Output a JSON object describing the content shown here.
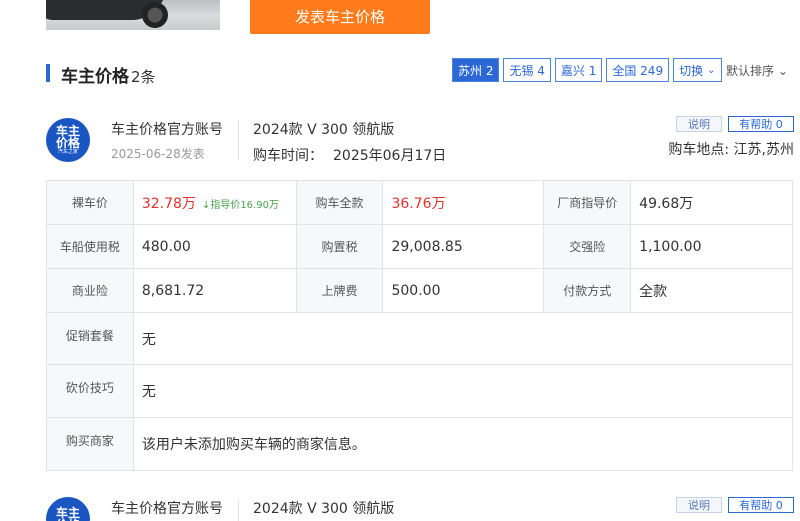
{
  "top": {
    "publish_label": "发表车主价格"
  },
  "section": {
    "title": "车主价格",
    "count": "2条"
  },
  "cities": [
    {
      "label": "苏州 2",
      "active": true
    },
    {
      "label": "无锡 4"
    },
    {
      "label": "嘉兴 1"
    },
    {
      "label": "全国 249"
    },
    {
      "label": "切换"
    }
  ],
  "sort": {
    "label": "默认排序"
  },
  "records": [
    {
      "avatar_text_big": "车主\n价格",
      "avatar_text_small": "汽车之家",
      "owner": "车主价格官方账号",
      "date": "2025-06-28发表",
      "model": "2024款 V 300 领航版",
      "buy_date_label": "购车时间：",
      "buy_date": "2025年06月17日",
      "explain": "说明",
      "helpful": "有帮助 0",
      "location": "购车地点: 江苏,苏州",
      "rows": {
        "bare_price_label": "裸车价",
        "bare_price": "32.78万",
        "guide_note": "↓指导价16.90万",
        "total_label": "购车全款",
        "total": "36.76万",
        "msrp_label": "厂商指导价",
        "msrp": "49.68万",
        "vehicle_tax_label": "车船使用税",
        "vehicle_tax": "480.00",
        "purchase_tax_label": "购置税",
        "purchase_tax": "29,008.85",
        "compulsory_label": "交强险",
        "compulsory": "1,100.00",
        "commercial_label": "商业险",
        "commercial": "8,681.72",
        "plate_label": "上牌费",
        "plate": "500.00",
        "payment_label": "付款方式",
        "payment": "全款",
        "promo_label": "促销套餐",
        "promo": "无",
        "bargain_label": "砍价技巧",
        "bargain": "无",
        "dealer_label": "购买商家",
        "dealer": "该用户未添加购买车辆的商家信息。"
      }
    },
    {
      "avatar_text_big": "车主\n价格",
      "owner": "车主价格官方账号",
      "model": "2024款 V 300 领航版",
      "explain": "说明",
      "helpful": "有帮助 0"
    }
  ]
}
